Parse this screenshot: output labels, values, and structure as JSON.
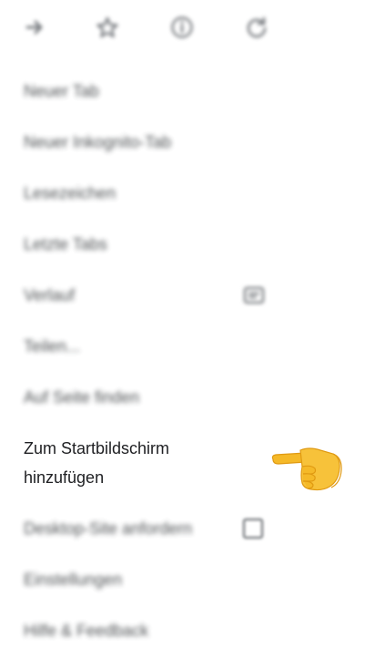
{
  "toolbar": {
    "icons": [
      "forward-arrow-icon",
      "star-icon",
      "info-icon",
      "reload-icon"
    ]
  },
  "menu": {
    "items": [
      {
        "label": "Neuer Tab"
      },
      {
        "label": "Neuer Inkognito-Tab"
      },
      {
        "label": "Lesezeichen"
      },
      {
        "label": "Letzte Tabs"
      },
      {
        "label": "Verlauf"
      },
      {
        "label": "Teilen..."
      },
      {
        "label": "Auf Seite finden"
      },
      {
        "label_line1": "Zum Startbildschirm",
        "label_line2": "hinzufügen"
      },
      {
        "label": "Desktop-Site anfordern"
      },
      {
        "label": "Einstellungen"
      },
      {
        "label": "Hilfe & Feedback"
      }
    ]
  },
  "annotation": {
    "icon": "pointing-hand-icon",
    "color": "#F5B928"
  },
  "colors": {
    "text": "#202124",
    "icon": "#5f6368",
    "background": "#ffffff"
  }
}
